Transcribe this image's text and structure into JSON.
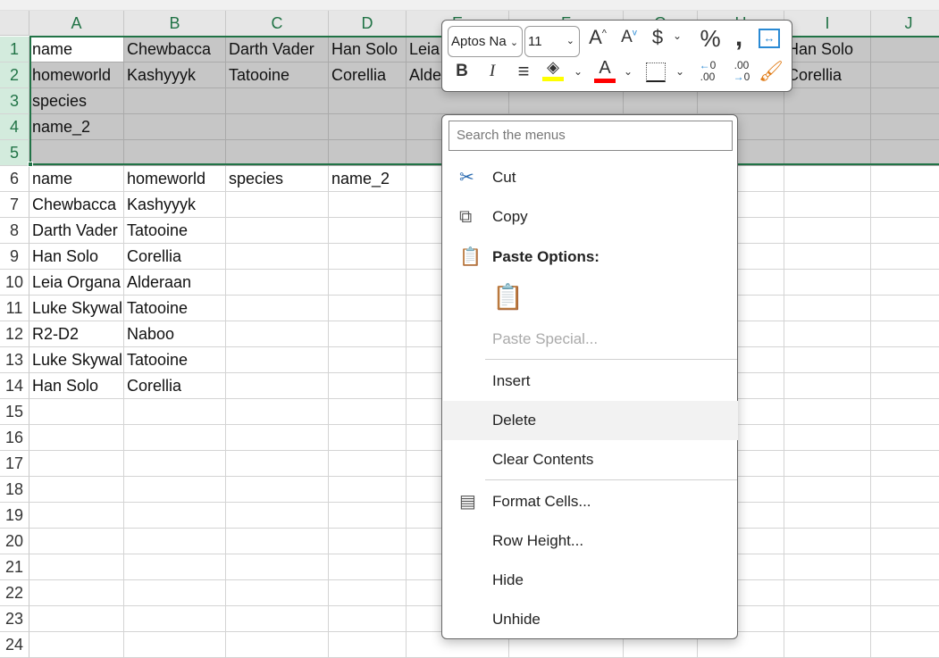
{
  "columns": [
    "A",
    "B",
    "C",
    "D",
    "E",
    "F",
    "G",
    "H",
    "I",
    "J"
  ],
  "rows": [
    "1",
    "2",
    "3",
    "4",
    "5",
    "6",
    "7",
    "8",
    "9",
    "10",
    "11",
    "12",
    "13",
    "14",
    "15",
    "16",
    "17",
    "18",
    "19",
    "20",
    "21",
    "22",
    "23",
    "24"
  ],
  "cells": [
    [
      "name",
      "Chewbacca",
      "Darth Vader",
      "Han Solo",
      "Leia",
      "",
      "",
      "",
      "Han Solo",
      ""
    ],
    [
      "homeworld",
      "Kashyyyk",
      "Tatooine",
      "Corellia",
      "Alderaan",
      "",
      "",
      "",
      "Corellia",
      ""
    ],
    [
      "species",
      "",
      "",
      "",
      "",
      "",
      "",
      "",
      "",
      ""
    ],
    [
      "name_2",
      "",
      "",
      "",
      "",
      "",
      "",
      "",
      "",
      ""
    ],
    [
      "",
      "",
      "",
      "",
      "",
      "",
      "",
      "",
      "",
      ""
    ],
    [
      "name",
      "homeworld",
      "species",
      "name_2",
      "",
      "",
      "",
      "",
      "",
      ""
    ],
    [
      "Chewbacca",
      "Kashyyyk",
      "",
      "",
      "",
      "",
      "",
      "",
      "",
      ""
    ],
    [
      "Darth Vader",
      "Tatooine",
      "",
      "",
      "",
      "",
      "",
      "",
      "",
      ""
    ],
    [
      "Han Solo",
      "Corellia",
      "",
      "",
      "",
      "",
      "",
      "",
      "",
      ""
    ],
    [
      "Leia Organa",
      "Alderaan",
      "",
      "",
      "",
      "",
      "",
      "",
      "",
      ""
    ],
    [
      "Luke Skywalker",
      "Tatooine",
      "",
      "",
      "",
      "",
      "",
      "",
      "",
      ""
    ],
    [
      "R2-D2",
      "Naboo",
      "",
      "",
      "",
      "",
      "",
      "",
      "",
      ""
    ],
    [
      "Luke Skywalker",
      "Tatooine",
      "",
      "",
      "",
      "",
      "",
      "",
      "",
      ""
    ],
    [
      "Han Solo",
      "Corellia",
      "",
      "",
      "",
      "",
      "",
      "",
      "",
      ""
    ]
  ],
  "mini_toolbar": {
    "font": "Aptos Na",
    "size": "11",
    "fill_color": "#ffff00",
    "font_color": "#ff0000"
  },
  "context_menu": {
    "search_placeholder": "Search the menus",
    "cut": "Cut",
    "copy": "Copy",
    "paste_options": "Paste Options:",
    "paste_special": "Paste Special...",
    "insert": "Insert",
    "delete": "Delete",
    "clear_contents": "Clear Contents",
    "format_cells": "Format Cells...",
    "row_height": "Row Height...",
    "hide": "Hide",
    "unhide": "Unhide"
  },
  "accent": "#217346"
}
